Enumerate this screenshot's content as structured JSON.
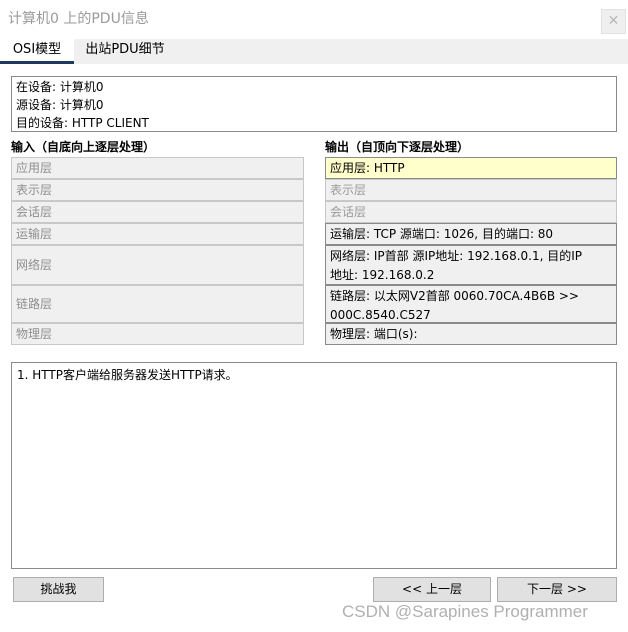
{
  "window": {
    "title": "计算机0 上的PDU信息",
    "close_label": "✕"
  },
  "tabs": [
    {
      "label": "OSI模型",
      "active": true
    },
    {
      "label": "出站PDU细节",
      "active": false
    }
  ],
  "device_info": {
    "at_device": "在设备: 计算机0",
    "source_device": "源设备: 计算机0",
    "dest_device": "目的设备: HTTP CLIENT"
  },
  "inbound": {
    "header": "输入（自底向上逐层处理）",
    "layers": [
      "应用层",
      "表示层",
      "会话层",
      "运输层",
      "网络层",
      "链路层",
      "物理层"
    ]
  },
  "outbound": {
    "header": "输出（自顶向下逐层处理）",
    "layers": [
      {
        "lines": [
          "应用层: HTTP"
        ],
        "state": "highlight"
      },
      {
        "lines": [
          "表示层"
        ],
        "state": "disabled"
      },
      {
        "lines": [
          "会话层"
        ],
        "state": "disabled"
      },
      {
        "lines": [
          "运输层: TCP 源端口: 1026, 目的端口: 80"
        ],
        "state": "active"
      },
      {
        "lines": [
          "网络层: IP首部 源IP地址: 192.168.0.1, 目的IP",
          "地址: 192.168.0.2"
        ],
        "state": "active"
      },
      {
        "lines": [
          "链路层: 以太网V2首部 0060.70CA.4B6B >>",
          "000C.8540.C527"
        ],
        "state": "active"
      },
      {
        "lines": [
          "物理层: 端口(s):"
        ],
        "state": "active"
      }
    ]
  },
  "description": {
    "text": "1. HTTP客户端给服务器发送HTTP请求。"
  },
  "buttons": {
    "challenge": "挑战我",
    "prev": "<< 上一层",
    "next": "下一层 >>"
  },
  "watermark": "CSDN @Sarapines Programmer"
}
